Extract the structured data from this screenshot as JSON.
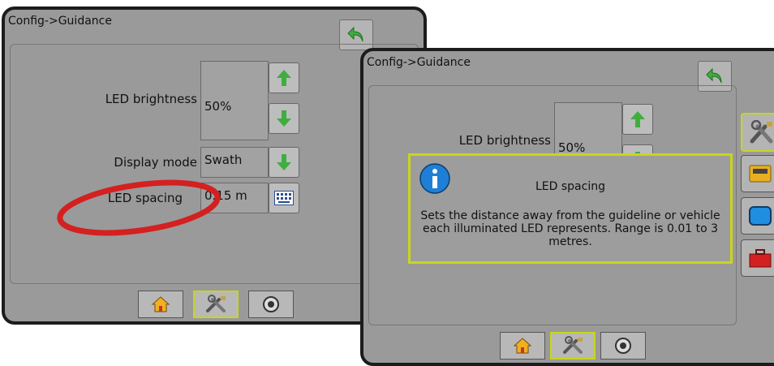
{
  "left_screen": {
    "title": "Config->Guidance",
    "rows": {
      "brightness": {
        "label": "LED brightness",
        "value": "50%"
      },
      "display_mode": {
        "label": "Display mode",
        "value": "Swath"
      },
      "spacing": {
        "label": "LED spacing",
        "value": "0.15 m"
      }
    },
    "bottom_tabs": [
      "home-icon",
      "tools-icon",
      "gps-icon"
    ],
    "active_tab": "tools-icon"
  },
  "right_screen": {
    "title": "Config->Guidance",
    "rows": {
      "brightness": {
        "label": "LED brightness",
        "value": "50%"
      }
    },
    "popup": {
      "title": "LED spacing",
      "body": "Sets the distance away from the guideline or vehicle each illuminated LED represents. Range is 0.01 to 3 metres."
    },
    "side_buttons": [
      "tools-icon",
      "console-icon",
      "display-icon",
      "toolbox-icon"
    ],
    "bottom_tabs": [
      "home-icon",
      "tools-icon",
      "gps-icon"
    ],
    "active_tab": "tools-icon"
  },
  "colors": {
    "screen_bg": "#9a9a9a",
    "accent": "#c9d61a",
    "highlight_ring": "#d42020",
    "arrow_green": "#3fae3f",
    "info_blue": "#1f7fd6"
  }
}
